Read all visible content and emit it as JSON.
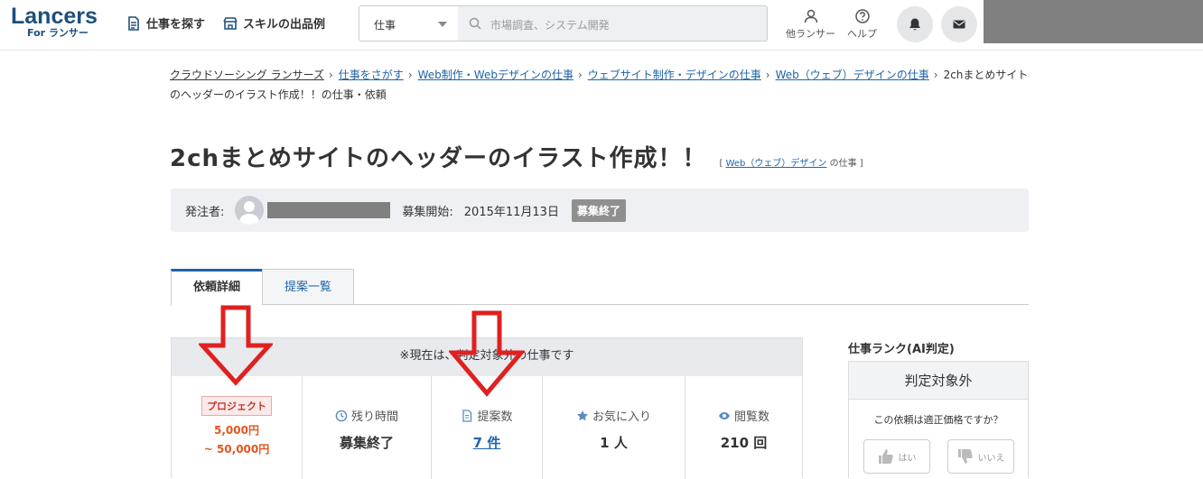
{
  "header": {
    "logo_main": "Lancers",
    "logo_sub": "For ランサー",
    "nav": [
      {
        "label": "仕事を探す",
        "icon": "document-icon"
      },
      {
        "label": "スキルの出品例",
        "icon": "shop-icon"
      }
    ],
    "search": {
      "select_value": "仕事",
      "placeholder": "市場調査、システム開発"
    },
    "links": [
      {
        "label": "他ランサー",
        "icon": "person-icon"
      },
      {
        "label": "ヘルプ",
        "icon": "help-icon"
      }
    ],
    "buttons": [
      {
        "icon": "bell-icon"
      },
      {
        "icon": "mail-icon"
      }
    ]
  },
  "breadcrumb": {
    "items": [
      "クラウドソーシング ランサーズ",
      "仕事をさがす",
      "Web制作・Webデザインの仕事",
      "ウェブサイト制作・デザインの仕事",
      "Web（ウェブ）デザインの仕事"
    ],
    "current": "2chまとめサイトのヘッダーのイラスト作成！！の仕事・依頼",
    "sep": "›"
  },
  "job": {
    "title": "2chまとめサイトのヘッダーのイラスト作成！！",
    "category_open": "[",
    "category_link": "Web（ウェブ）デザイン",
    "category_suffix": "の仕事 ]",
    "client_label": "発注者:",
    "start_label": "募集開始:",
    "start_date": "2015年11月13日",
    "status": "募集終了"
  },
  "tabs": [
    {
      "label": "依頼詳細",
      "active": true
    },
    {
      "label": "提案一覧",
      "active": false
    }
  ],
  "info": {
    "notice": "※現在は、判定対象外の仕事です",
    "project_badge": "プロジェクト",
    "price_min": "5,000円",
    "price_max": "~ 50,000円",
    "remaining_label": "残り時間",
    "remaining_value": "募集終了",
    "proposals_label": "提案数",
    "proposals_value": "7 件",
    "favorites_label": "お気に入り",
    "favorites_value": "1 人",
    "views_label": "閲覧数",
    "views_value": "210 回"
  },
  "rank": {
    "title": "仕事ランク(AI判定)",
    "result": "判定対象外",
    "question": "この依頼は適正価格ですか？",
    "yes": "はい",
    "no": "いいえ"
  },
  "colors": {
    "brand": "#1e4f7c",
    "link": "#1e64a8",
    "price": "#e2561e",
    "annotation": "#e02020"
  }
}
